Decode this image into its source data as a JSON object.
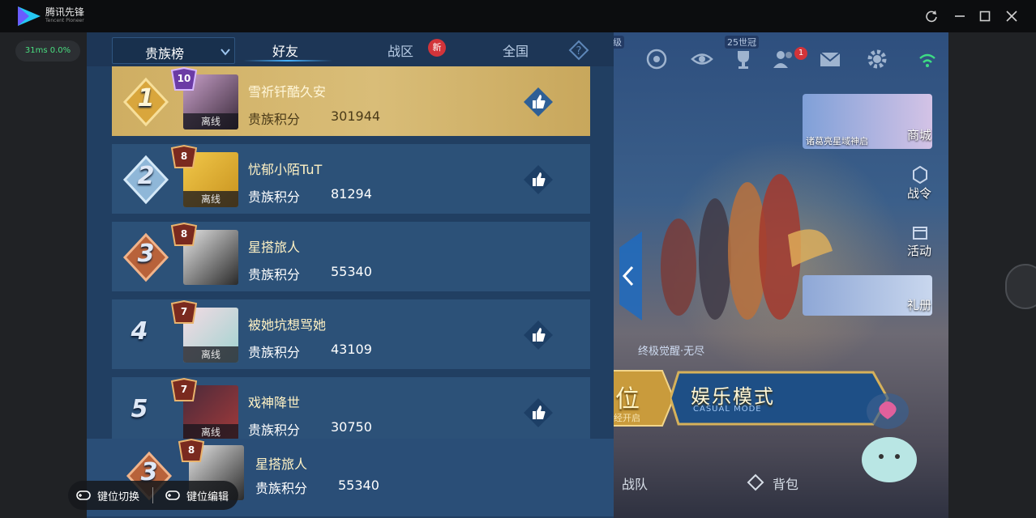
{
  "window": {
    "app_name": "腾讯先锋",
    "app_subtitle": "Tencent Pioneer",
    "ping": "31ms  0.0%"
  },
  "leaderboard": {
    "dropdown_label": "贵族榜",
    "tabs": [
      {
        "label": "好友"
      },
      {
        "label": "战区"
      },
      {
        "label": "全国"
      }
    ],
    "new_badge": "新",
    "rows": [
      {
        "rank": "1",
        "level": "10",
        "name": "雪祈钎酷久安",
        "score_label": "贵族积分",
        "score": "301944",
        "status": "离线"
      },
      {
        "rank": "2",
        "level": "8",
        "name": "忧郁小陌TuT",
        "score_label": "贵族积分",
        "score": "81294",
        "status": "离线"
      },
      {
        "rank": "3",
        "level": "8",
        "name": "星搭旅人",
        "score_label": "贵族积分",
        "score": "55340",
        "status": ""
      },
      {
        "rank": "4",
        "level": "7",
        "name": "被她坑想骂她",
        "score_label": "贵族积分",
        "score": "43109",
        "status": "离线"
      },
      {
        "rank": "5",
        "level": "7",
        "name": "戏神降世",
        "score_label": "贵族积分",
        "score": "30750",
        "status": "离线"
      }
    ],
    "self_row": {
      "rank": "3",
      "level": "8",
      "name": "星搭旅人",
      "score_label": "贵族积分",
      "score": "55340"
    }
  },
  "game": {
    "tier_tags": [
      "级",
      "25世冠"
    ],
    "mail_count": "1",
    "side_items": [
      "商城",
      "战令",
      "活动",
      "礼册"
    ],
    "banner_caption": "诸葛亮星域神启",
    "hero_caption": "终极觉醒·无尽",
    "rank_button": {
      "label": "位",
      "sub": "经开启"
    },
    "mode_button": {
      "label": "娱乐模式",
      "sub": "CASUAL MODE"
    },
    "bottom_buttons": [
      "战队",
      "背包"
    ]
  },
  "keybar": {
    "switch_label": "键位切换",
    "edit_label": "键位编辑"
  },
  "colors": {
    "panel_bg": "#213f62",
    "row_bg": "#2c5178",
    "first_row_gold": "#d9bd78",
    "new_badge": "#d2343a",
    "ping_green": "#4ade80"
  }
}
